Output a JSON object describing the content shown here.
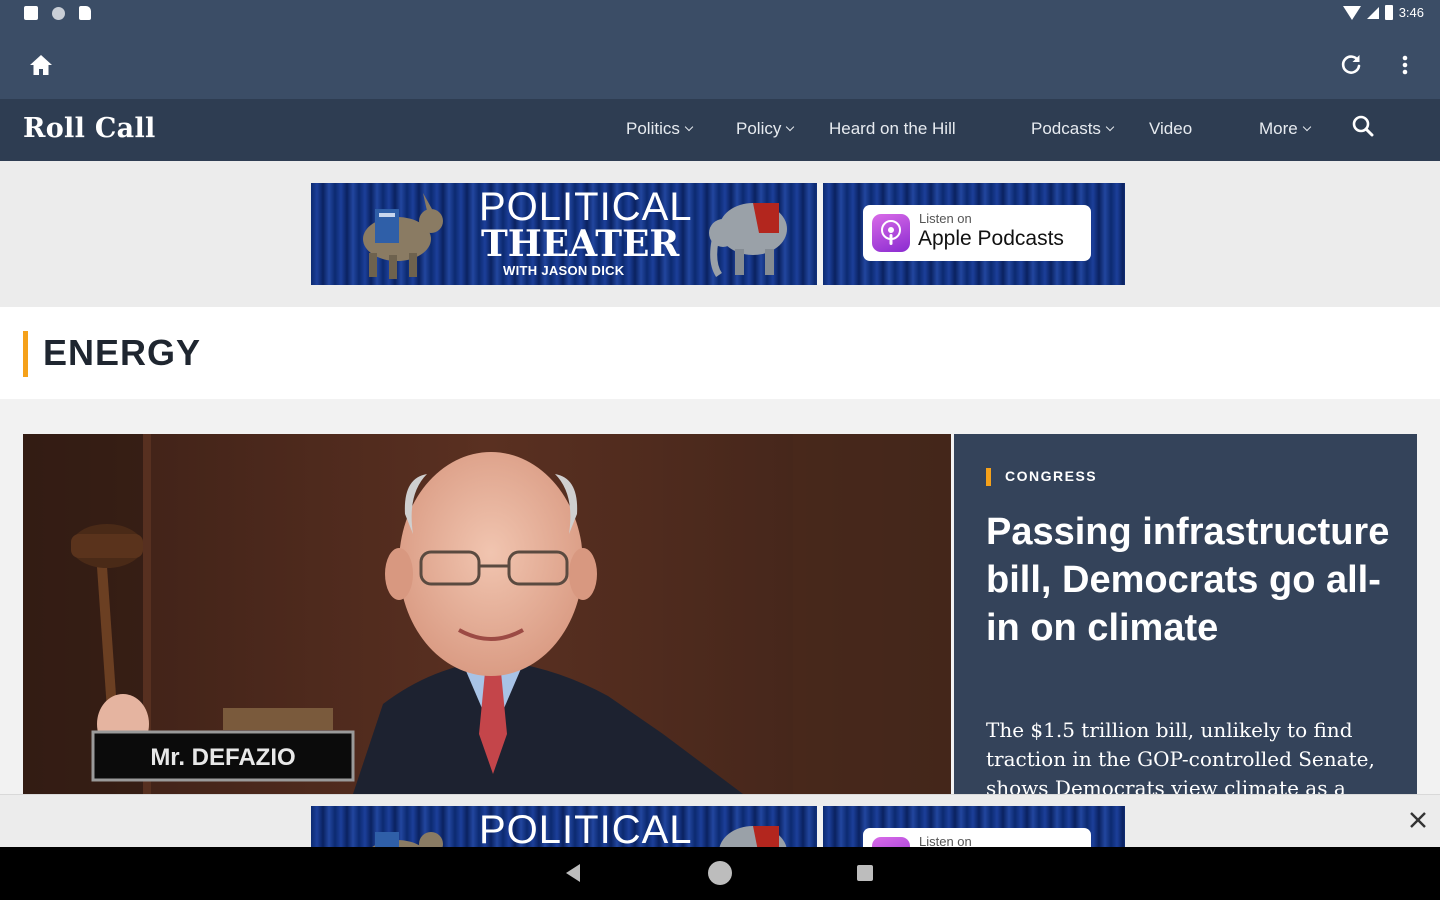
{
  "status_bar": {
    "time": "3:46"
  },
  "site": {
    "logo": "Roll Call"
  },
  "nav": {
    "items": [
      {
        "label": "Politics",
        "has_menu": true
      },
      {
        "label": "Policy",
        "has_menu": true
      },
      {
        "label": "Heard on the Hill",
        "has_menu": false
      },
      {
        "label": "Podcasts",
        "has_menu": true
      },
      {
        "label": "Video",
        "has_menu": false
      },
      {
        "label": "More",
        "has_menu": true
      }
    ]
  },
  "ad": {
    "title_line1": "POLITICAL",
    "title_line2": "THEATER",
    "subtitle": "WITH JASON DICK",
    "listen_small": "Listen on",
    "listen_big": "Apple Podcasts"
  },
  "section": {
    "title": "ENERGY"
  },
  "hero": {
    "kicker": "CONGRESS",
    "headline": "Passing infrastructure bill, Democrats go all-in on climate",
    "dek": "The $1.5 trillion bill, unlikely to find traction in the GOP-controlled Senate, shows Democrats view climate as a",
    "nameplate": "Mr. DEFAZIO"
  },
  "colors": {
    "toolbar": "#3b4d66",
    "nav": "#2e3d52",
    "accent": "#f5a11a",
    "hero_panel": "#34435a"
  },
  "icons": [
    "home-icon",
    "refresh-icon",
    "overflow-menu-icon",
    "search-icon",
    "close-icon",
    "podcasts-icon",
    "nav-back-icon",
    "nav-home-icon",
    "nav-recents-icon"
  ]
}
